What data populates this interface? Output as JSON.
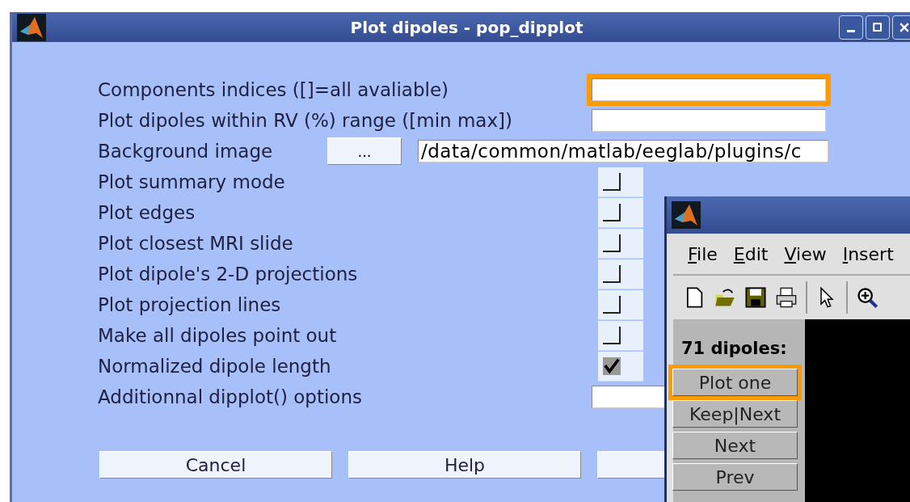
{
  "window": {
    "title": "Plot dipoles - pop_dipplot"
  },
  "rows": [
    {
      "kind": "field",
      "label": "Components indices ([]=all avaliable)",
      "highlighted": true
    },
    {
      "kind": "field",
      "label": "Plot dipoles within RV (%) range ([min max])",
      "highlighted": false
    },
    {
      "kind": "browse",
      "label": "Background image",
      "button": "...",
      "value": "/data/common/matlab/eeglab/plugins/c"
    },
    {
      "kind": "checkbox",
      "label": "Plot summary mode",
      "checked": false
    },
    {
      "kind": "checkbox",
      "label": "Plot edges",
      "checked": false
    },
    {
      "kind": "checkbox",
      "label": "Plot closest MRI slide",
      "checked": false
    },
    {
      "kind": "checkbox",
      "label": "Plot dipole's 2-D projections",
      "checked": false
    },
    {
      "kind": "checkbox",
      "label": "Plot projection lines",
      "checked": false
    },
    {
      "kind": "checkbox",
      "label": "Make all dipoles point out",
      "checked": false
    },
    {
      "kind": "checkbox",
      "label": "Normalized dipole length",
      "checked": true
    },
    {
      "kind": "field",
      "label": "Additionnal dipplot() options",
      "highlighted": false
    }
  ],
  "buttons": [
    "Cancel",
    "Help"
  ],
  "figure": {
    "menu": [
      "File",
      "Edit",
      "View",
      "Insert"
    ],
    "status": "71 dipoles:",
    "buttons": [
      {
        "label": "Plot one",
        "highlighted": true
      },
      {
        "label": "Keep|Next",
        "highlighted": false
      },
      {
        "label": "Next",
        "highlighted": false
      },
      {
        "label": "Prev",
        "highlighted": false
      }
    ]
  }
}
